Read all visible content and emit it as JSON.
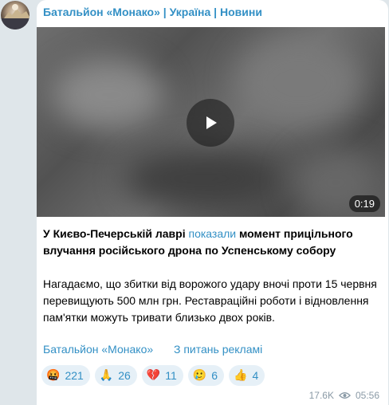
{
  "channel": {
    "name": "Батальйон «Монако» | Україна | Новини"
  },
  "video": {
    "duration": "0:19",
    "play_icon": "play-icon"
  },
  "post": {
    "line1_before": "У Києво-Печерській лаврі ",
    "line1_link": "показали",
    "line1_after": " момент прицільного влучання російського дрона по Успенському собору",
    "paragraph2": "Нагадаємо, що збитки від ворожого удару вночі проти 15 червня перевищують 500 млн грн. Реставраційні роботи і відновлення пам'ятки можуть тривати близько двох років."
  },
  "footer": {
    "channel_link": "Батальйон «Монако»",
    "ads_link": "З питань рекламі"
  },
  "reactions": [
    {
      "emoji": "🤬",
      "count": "221"
    },
    {
      "emoji": "🙏",
      "count": "26"
    },
    {
      "emoji": "💔",
      "count": "11"
    },
    {
      "emoji": "🥲",
      "count": "6"
    },
    {
      "emoji": "👍",
      "count": "4"
    }
  ],
  "meta": {
    "views": "17.6K",
    "time": "05:56",
    "views_icon": "eye-icon"
  }
}
